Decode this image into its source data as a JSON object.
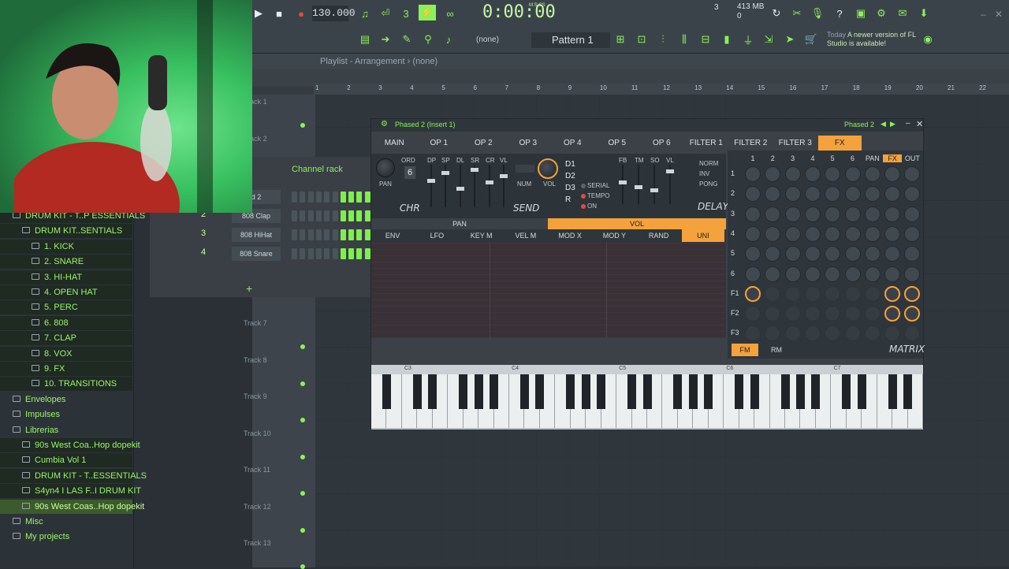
{
  "toolbar": {
    "tempo": "130.000",
    "time": "0:00:00",
    "time_label": "M:S:CS",
    "pattern": "Pattern 1",
    "none": "(none)",
    "cpu_poly": "3",
    "mem": "413 MB",
    "mem2": "0",
    "news_today": "Today",
    "news_text": "A newer version of FL Studio is available!"
  },
  "playlist": {
    "title": "Playlist - Arrangement",
    "arrangement": "(none)",
    "ruler": [
      "1",
      "2",
      "3",
      "4",
      "5",
      "6",
      "7",
      "8",
      "9",
      "10",
      "11",
      "12",
      "13",
      "14",
      "15",
      "16",
      "17",
      "18",
      "19",
      "20",
      "21",
      "22"
    ],
    "tracks": [
      "Track 1",
      "Track 2",
      "Track 7",
      "Track 8",
      "Track 9",
      "Track 10",
      "Track 11",
      "Track 12",
      "Track 13"
    ]
  },
  "browser": {
    "items": [
      {
        "label": "DRUM KIT - T..P ESSENTIALS",
        "indent": 0
      },
      {
        "label": "DRUM KIT..SENTIALS",
        "indent": 1
      },
      {
        "label": "1. KICK",
        "indent": 2
      },
      {
        "label": "2. SNARE",
        "indent": 2
      },
      {
        "label": "3. HI-HAT",
        "indent": 2
      },
      {
        "label": "4. OPEN HAT",
        "indent": 2
      },
      {
        "label": "5. PERC",
        "indent": 2
      },
      {
        "label": "6. 808",
        "indent": 2
      },
      {
        "label": "7. CLAP",
        "indent": 2
      },
      {
        "label": "8. VOX",
        "indent": 2
      },
      {
        "label": "9. FX",
        "indent": 2
      },
      {
        "label": "10. TRANSITIONS",
        "indent": 2
      },
      {
        "label": "Envelopes",
        "indent": 0
      },
      {
        "label": "Impulses",
        "indent": 0
      },
      {
        "label": "Librerias",
        "indent": 0
      },
      {
        "label": "90s West Coa..Hop dopekit",
        "indent": 1
      },
      {
        "label": "Cumbia Vol 1",
        "indent": 1
      },
      {
        "label": "DRUM KIT - T..ESSENTIALS",
        "indent": 1
      },
      {
        "label": "S4yn4 I LAS F..I DRUM KIT",
        "indent": 1
      },
      {
        "label": "90s West Coas..Hop dopekit",
        "indent": 1
      },
      {
        "label": "Misc",
        "indent": 0
      },
      {
        "label": "My projects",
        "indent": 0
      }
    ]
  },
  "channel_rack": {
    "title": "Channel rack",
    "channels": [
      {
        "num": "",
        "name": "d 2"
      },
      {
        "num": "2",
        "name": "808 Clap"
      },
      {
        "num": "3",
        "name": "808 HiHat"
      },
      {
        "num": "4",
        "name": "808 Snare"
      }
    ],
    "add": "+"
  },
  "plugin": {
    "title": "Phased 2 (Insert 1)",
    "title_right": "Phased 2",
    "tabs": [
      "MAIN",
      "OP 1",
      "OP 2",
      "OP 3",
      "OP 4",
      "OP 5",
      "OP 6",
      "FILTER 1",
      "FILTER 2",
      "FILTER 3",
      "FX"
    ],
    "active_tab": "FX",
    "chorus_labels": [
      "ORD",
      "DP",
      "SP",
      "DL",
      "SR",
      "CR",
      "VL"
    ],
    "ord_value": "6",
    "pan_label": "PAN",
    "chr_label": "CHR",
    "num_label": "NUM",
    "vol_label": "VOL",
    "send_label": "SEND",
    "delay_lines": [
      "D1",
      "D2",
      "D3",
      "R"
    ],
    "delay_opts": [
      "SERIAL",
      "TEMPO",
      "ON"
    ],
    "delay_labels": [
      "FB",
      "TM",
      "SO",
      "VL"
    ],
    "delay_modes": [
      "NORM",
      "INV",
      "PONG"
    ],
    "delay_label": "DELAY",
    "panvol": [
      "PAN",
      "VOL"
    ],
    "mod_tabs": [
      "ENV",
      "LFO",
      "KEY M",
      "VEL M",
      "MOD X",
      "MOD Y",
      "RAND",
      "UNI"
    ],
    "active_mod": "UNI",
    "matrix_cols": [
      "1",
      "2",
      "3",
      "4",
      "5",
      "6",
      "PAN",
      "FX",
      "OUT"
    ],
    "matrix_rows": [
      "1",
      "2",
      "3",
      "4",
      "5",
      "6",
      "F1",
      "F2",
      "F3"
    ],
    "fm": "FM",
    "rm": "RM",
    "matrix_label": "MATRIX",
    "kb_labels": [
      "C3",
      "C4",
      "C5",
      "C6",
      "C7"
    ]
  },
  "colors": {
    "accent": "#f4a23c",
    "fl_green": "#8cf05a",
    "bg": "#2a3036"
  }
}
